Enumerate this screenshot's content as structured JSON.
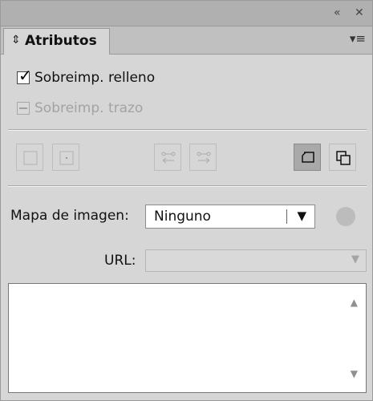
{
  "titlebar": {
    "collapse_icon": "«",
    "close_icon": "✕"
  },
  "tab": {
    "arrows_icon": "⇕",
    "label": "Atributos",
    "menu_icon": "▾≡"
  },
  "options": {
    "fill_overprint_label": "Sobreimp. relleno",
    "fill_overprint_checked": true,
    "stroke_overprint_label": "Sobreimp. trazo",
    "stroke_overprint_enabled": false
  },
  "image_map": {
    "label": "Mapa de imagen:",
    "selected": "Ninguno",
    "dropdown_arrow": "▼"
  },
  "url": {
    "label": "URL:",
    "value": "",
    "dropdown_arrow": "▼"
  },
  "textarea": {
    "scroll_up": "▲",
    "scroll_down": "▼"
  },
  "colors": {
    "panel_bg": "#d6d6d6",
    "disabled_text": "#a3a3a3"
  }
}
